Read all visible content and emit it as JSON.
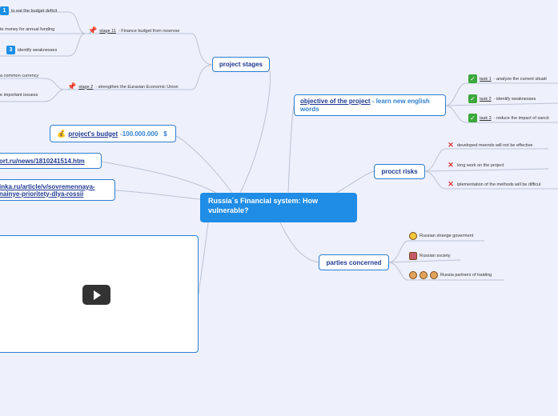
{
  "central": {
    "title": "Russia`s Financial system: How vulnerable?"
  },
  "project_stages": {
    "label": "project stages",
    "stage11": {
      "label": "stage 11",
      "text": " - Finance budget from reservse"
    },
    "stage2": {
      "label": "stage 2",
      "text": " - strengthen the Eurasian Economic Union"
    },
    "items": [
      {
        "num": "1",
        "text": "to eat the budget deficit"
      },
      {
        "num": "",
        "text": "te money for annual funding"
      },
      {
        "num": "3",
        "text": "identify weaknesses"
      }
    ],
    "items2": [
      {
        "text": "a common currency"
      },
      {
        "text": "e important issuess"
      }
    ]
  },
  "budget": {
    "label": "project's budget",
    "value": " -100.000.000",
    "currency": "$"
  },
  "links": [
    {
      "text": "ort.ru/news/1810241514.htm"
    },
    {
      "line1": "inka.ru/article/v/sovremennaya-",
      "line2": "nainye-prioritety-dlya-rossii"
    }
  ],
  "objective": {
    "label": "objective of the project",
    "rest": " - learn new english words",
    "tasks": [
      {
        "label": "task 1",
        "text": " - analyze the current situati"
      },
      {
        "label": "task 2",
        "text": " - identify weaknesses"
      },
      {
        "label": "task 3",
        "text": " - reduce the impact of sancti"
      }
    ]
  },
  "risks": {
    "label": "procct risks",
    "items": [
      "developed meends will not be effective",
      "long work on the project",
      "iplementation of the methods will be difficul"
    ]
  },
  "parties": {
    "label": "parties concerned",
    "items": [
      "Russian strange goverment",
      "Russian society",
      "Russia partners of traiding"
    ]
  },
  "colors": {
    "background": "#eef0fb",
    "central": "#1f8ce6",
    "border": "#2f7fd0",
    "link": "#1f3a93"
  }
}
